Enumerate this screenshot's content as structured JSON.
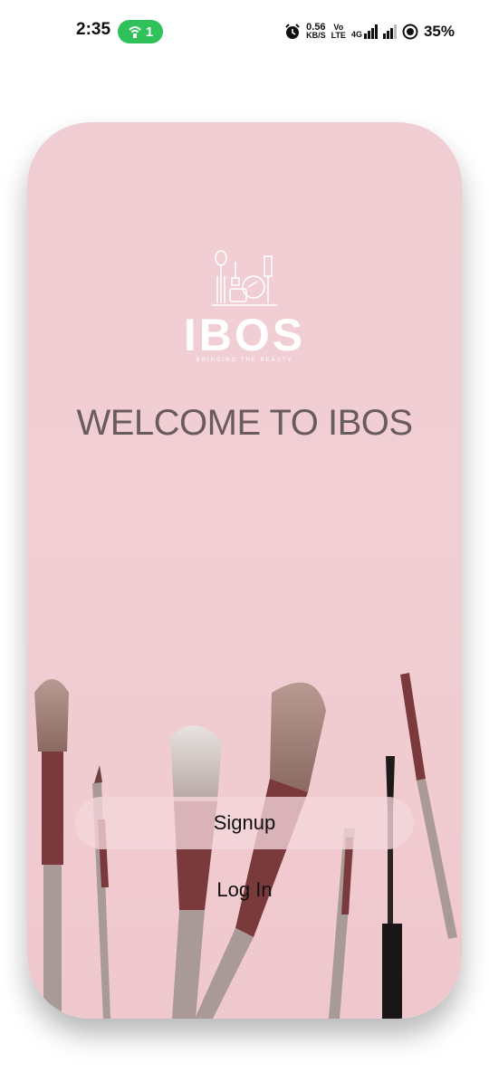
{
  "status_bar": {
    "time": "2:35",
    "hotspot_count": "1",
    "net_speed_value": "0.56",
    "net_speed_unit": "KB/S",
    "volte_top": "Vo",
    "volte_bottom": "LTE",
    "network_type": "4G",
    "battery": "35%"
  },
  "welcome": {
    "logo_text": "IBOS",
    "logo_tagline": "BRINGING THE BEAUTY",
    "heading": "WELCOME TO IBOS",
    "signup_label": "Signup",
    "login_label": "Log In"
  },
  "colors": {
    "card_pink": "#efcdd2",
    "heading": "#6a5c5e",
    "hotspot_green": "#2fc25b"
  }
}
